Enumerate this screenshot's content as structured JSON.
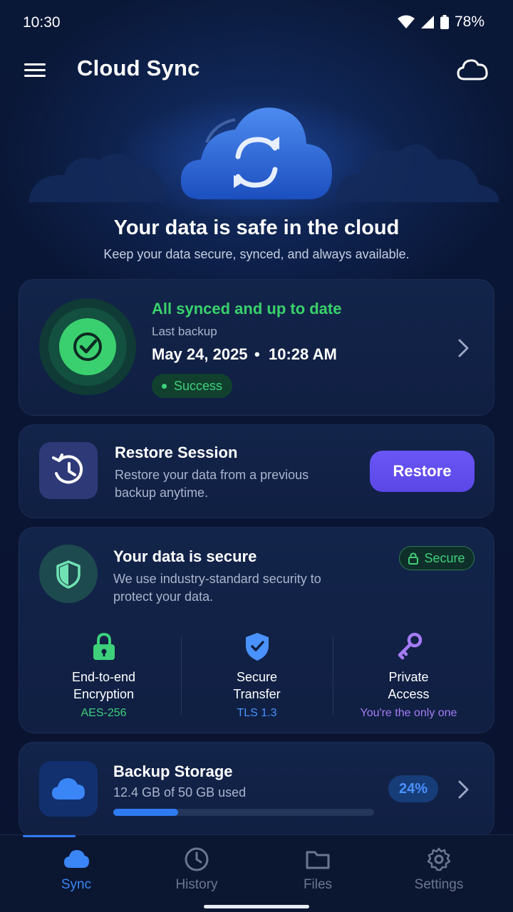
{
  "status_bar": {
    "time": "10:30",
    "battery": "78%"
  },
  "app_bar": {
    "title": "Cloud Sync"
  },
  "hero": {
    "title": "Your data is safe in the cloud",
    "subtitle": "Keep your data secure, synced, and always available."
  },
  "sync_card": {
    "status": "All synced and up to date",
    "last_label": "Last backup",
    "date": "May 24, 2025",
    "separator": "•",
    "time": "10:28 AM",
    "badge": "Success",
    "accent": "#39d26b"
  },
  "restore": {
    "title": "Restore Session",
    "description": "Restore your data from a previous backup anytime.",
    "button": "Restore"
  },
  "security": {
    "title": "Your data is secure",
    "description": "We use industry-standard security to protect your data.",
    "badge": "Secure",
    "features": [
      {
        "name": "End-to-end\nEncryption",
        "detail": "AES-256",
        "icon": "lock-icon",
        "color": "#3ed07a"
      },
      {
        "name": "Secure\nTransfer",
        "detail": "TLS 1.3",
        "icon": "shield-check-icon",
        "color": "#4a92ff"
      },
      {
        "name": "Private\nAccess",
        "detail": "You're the only one",
        "icon": "key-icon",
        "color": "#a47cf5"
      }
    ]
  },
  "storage": {
    "title": "Backup Storage",
    "usage": "12.4 GB of 50 GB used",
    "percent_label": "24%",
    "used_fraction": 0.248
  },
  "nav": {
    "items": [
      {
        "label": "Sync",
        "icon": "cloud-icon",
        "active": true
      },
      {
        "label": "History",
        "icon": "clock-icon",
        "active": false
      },
      {
        "label": "Files",
        "icon": "folder-icon",
        "active": false
      },
      {
        "label": "Settings",
        "icon": "gear-icon",
        "active": false
      }
    ]
  }
}
